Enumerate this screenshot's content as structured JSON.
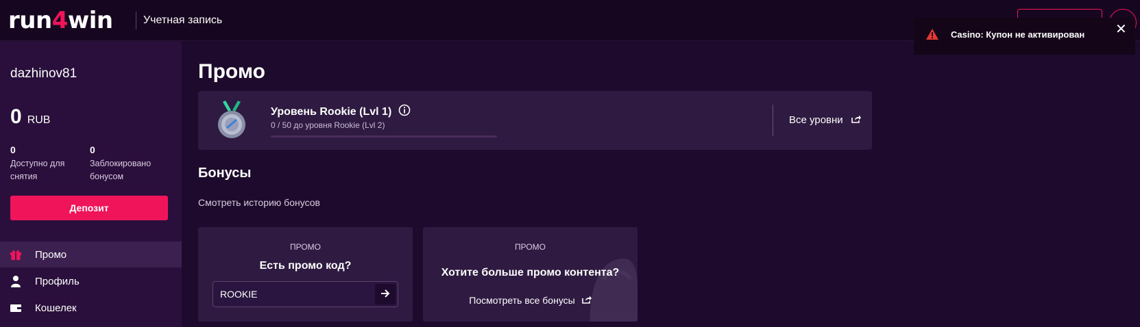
{
  "header": {
    "logo_prefix": "run",
    "logo_four": "4",
    "logo_suffix": "win",
    "account_label": "Учетная запись"
  },
  "sidebar": {
    "username": "dazhinov81",
    "balance_amount": "0",
    "balance_currency": "RUB",
    "available_value": "0",
    "available_label": "Доступно для снятия",
    "locked_value": "0",
    "locked_label": "Заблокировано бонусом",
    "deposit_label": "Депозит",
    "nav": [
      {
        "label": "Промо",
        "icon": "gift-icon",
        "active": true
      },
      {
        "label": "Профиль",
        "icon": "user-icon",
        "active": false
      },
      {
        "label": "Кошелек",
        "icon": "wallet-icon",
        "active": false
      }
    ]
  },
  "main": {
    "title": "Промо",
    "level": {
      "title": "Уровень Rookie (Lvl 1)",
      "progress_text": "0 / 50 до уровня Rookie (Lvl 2)",
      "progress_fraction": 0,
      "all_levels_label": "Все уровни"
    },
    "bonuses_title": "Бонусы",
    "history_link": "Смотреть историю бонусов",
    "promo_code_card": {
      "kicker": "ПРОМО",
      "heading": "Есть промо код?",
      "input_value": "ROOKIE"
    },
    "promo_content_card": {
      "kicker": "ПРОМО",
      "heading": "Хотите больше промо контента?",
      "link_label": "Посмотреть все бонусы"
    }
  },
  "toast": {
    "message": "Casino: Купон не активирован",
    "close_glyph": "✕"
  },
  "colors": {
    "accent": "#f0145a",
    "background": "#1e0a2c",
    "sidebar": "#2a0f3c",
    "card": "#2f1a42",
    "warning": "#e53935"
  }
}
